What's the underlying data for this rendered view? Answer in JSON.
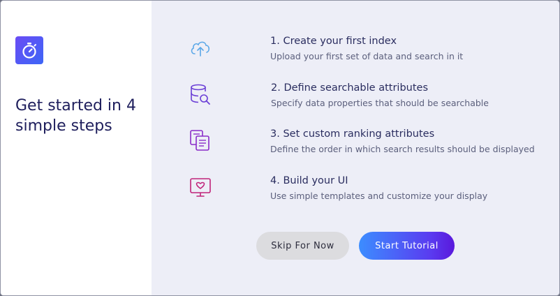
{
  "dialog": {
    "headline": "Get started in 4 simple steps",
    "app_icon": "stopwatch-icon"
  },
  "steps": [
    {
      "icon": "cloud-upload-icon",
      "title": "1. Create your first index",
      "description": "Upload your first set of data and search in it"
    },
    {
      "icon": "database-search-icon",
      "title": "2. Define searchable attributes",
      "description": "Specify data properties that should be searchable"
    },
    {
      "icon": "documents-list-icon",
      "title": "3. Set custom ranking attributes",
      "description": "Define the order in which search results should be displayed"
    },
    {
      "icon": "monitor-heart-icon",
      "title": "4. Build your UI",
      "description": "Use simple templates and customize your display"
    }
  ],
  "buttons": {
    "skip_label": "Skip For Now",
    "start_label": "Start Tutorial"
  },
  "colors": {
    "accent": "#5a3bf0",
    "step_icon_1": "#5aa7e8",
    "step_icon_2": "#6b3fd6",
    "step_icon_3": "#8a2bc9",
    "step_icon_4": "#c0237a"
  }
}
